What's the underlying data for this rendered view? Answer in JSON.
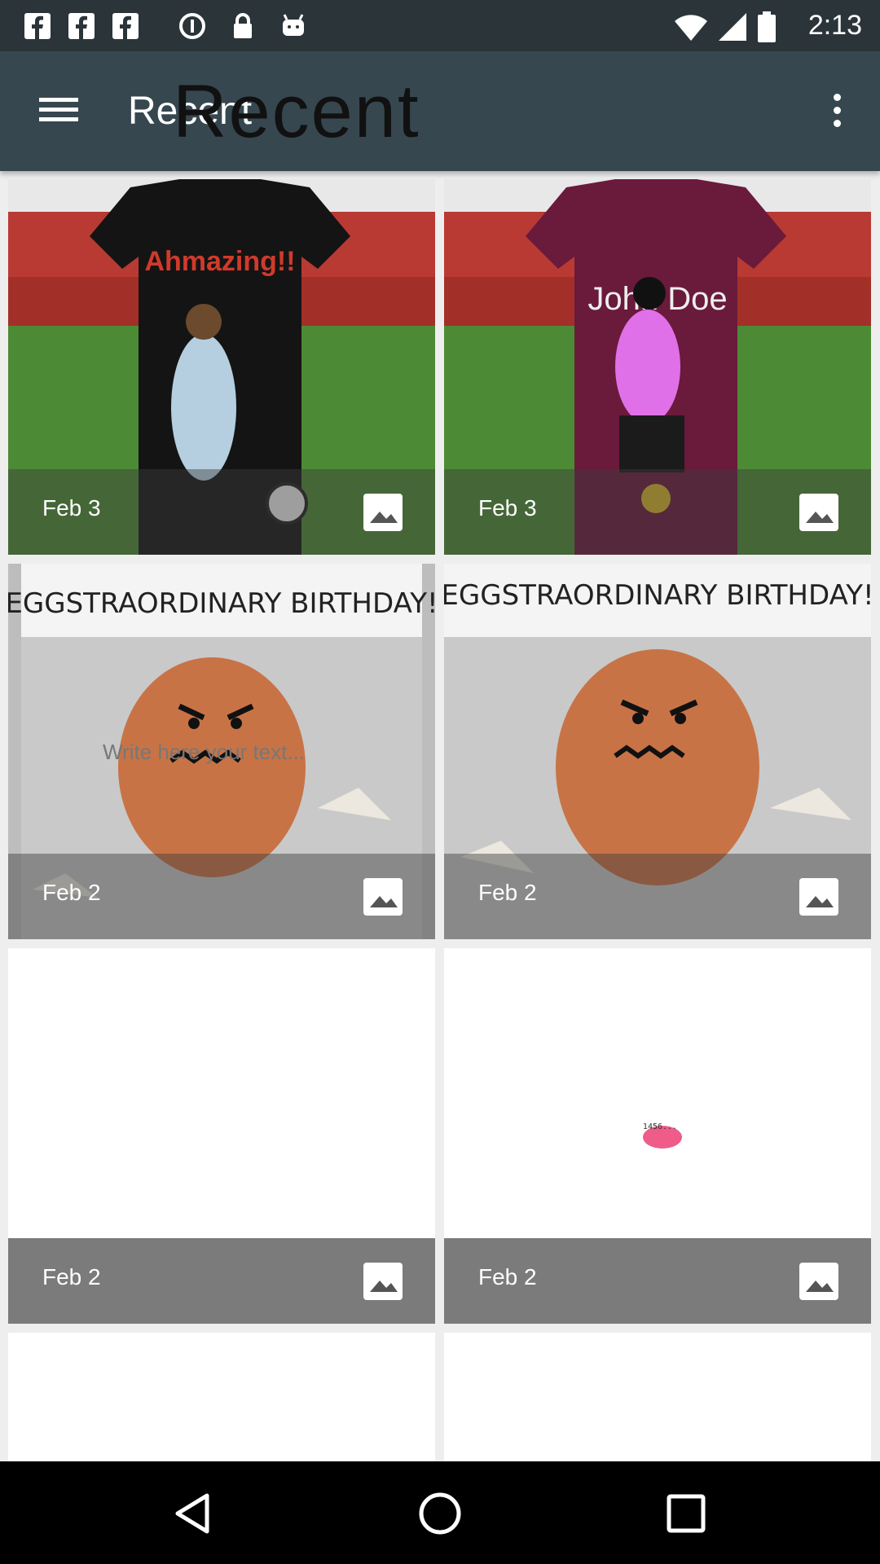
{
  "status_bar": {
    "time": "2:13",
    "notification_icons": [
      "facebook-icon",
      "facebook-icon",
      "facebook-icon",
      "data-saver-icon",
      "lock-icon",
      "android-icon"
    ]
  },
  "app_bar": {
    "title": "Recent",
    "title_overlay": "Recent"
  },
  "grid": {
    "tiles": [
      {
        "date": "Feb 3",
        "thumb_text": "Ahmazing!!",
        "kind": "jersey-black"
      },
      {
        "date": "Feb 3",
        "thumb_text": "John Doe",
        "kind": "jersey-maroon"
      },
      {
        "date": "Feb 2",
        "thumb_text": "EGGSTRAORDINARY BIRTHDAY!",
        "thumb_sub": "Write here your text...",
        "kind": "egg"
      },
      {
        "date": "Feb 2",
        "thumb_text": "EGGSTRAORDINARY BIRTHDAY!",
        "kind": "egg"
      },
      {
        "date": "Feb 2",
        "kind": "blank"
      },
      {
        "date": "Feb 2",
        "thumb_text": "1456...",
        "kind": "blank-pink"
      }
    ]
  },
  "colors": {
    "status_bar": "#2b3439",
    "app_bar": "#37474f",
    "grid_bg": "#eeeeee",
    "caption_solid": "#7b7b7b"
  }
}
